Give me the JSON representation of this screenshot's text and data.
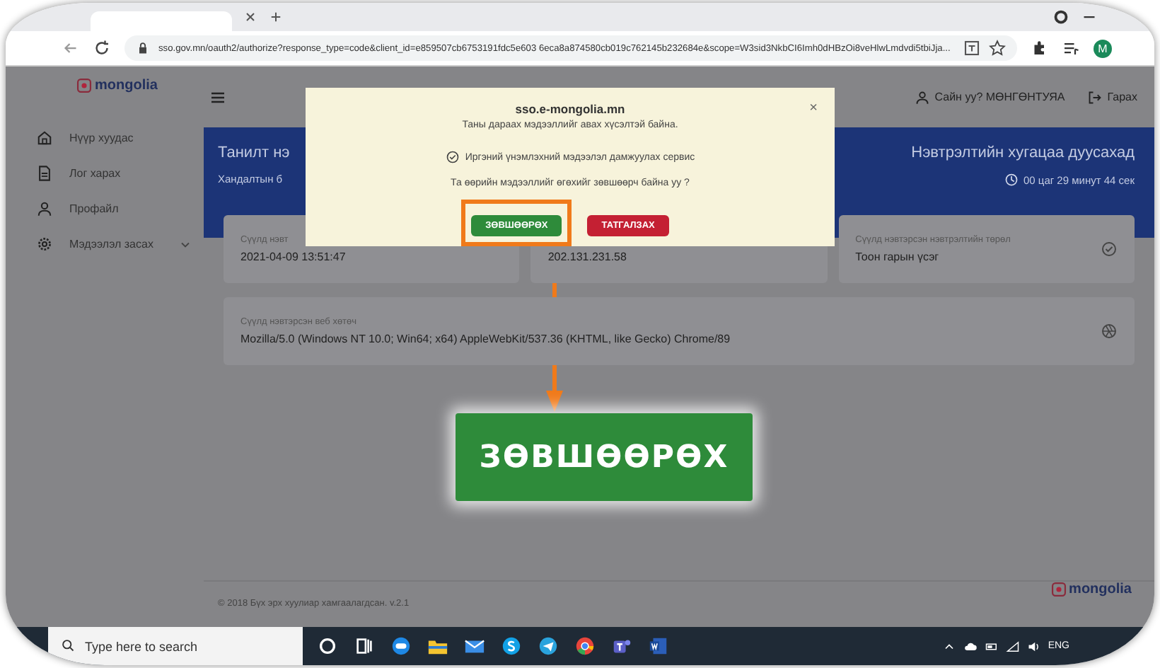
{
  "browser": {
    "url": "sso.gov.mn/oauth2/authorize?response_type=code&client_id=e859507cb6753191fdc5e603 6eca8a874580cb019c762145b232684e&scope=W3sid3NkbCI6Imh0dHBzOi8veHlwLmdvdi5tbiJja...",
    "profile_initial": "M"
  },
  "sidebar": {
    "logo": "mongolia",
    "items": [
      {
        "label": "Нүүр хуудас",
        "selected": false
      },
      {
        "label": "Лог харах",
        "selected": false
      },
      {
        "label": "Профайл",
        "selected": false
      },
      {
        "label": "Мэдээлэл засах",
        "selected": false,
        "expandable": true
      }
    ]
  },
  "header": {
    "greeting": "Сайн уу? МӨНГӨНТУЯА",
    "logout": "Гарах"
  },
  "banner": {
    "title": "Танилт нэ",
    "subtitle": "Хандалтын б",
    "expiry_title": "Нэвтрэлтийн хугацаа дуусахад",
    "countdown": "00 цаг 29 минут 44 сек"
  },
  "cards": [
    {
      "label": "Сүүлд нэвт",
      "value": "2021-04-09 13:51:47"
    },
    {
      "value": "202.131.231.58"
    },
    {
      "label": "Сүүлд нэвтэрсэн нэвтрэлтийн төрөл",
      "value": "Тоон гарын үсэг",
      "kind": "check"
    }
  ],
  "browser_card": {
    "label": "Сүүлд нэвтэрсэн веб хөтөч",
    "value": "Mozilla/5.0 (Windows NT 10.0; Win64; x64) AppleWebKit/537.36 (KHTML, like Gecko) Chrome/89"
  },
  "footer": {
    "copyright": "© 2018 Бүх эрх хуулиар хамгаалагдсан. v.2.1",
    "logo": "mongolia"
  },
  "dialog": {
    "site": "sso.e-mongolia.mn",
    "request": "Таны дараах мэдээллийг авах хүсэлтэй байна.",
    "service": "Иргэний үнэмлэхний мэдээлэл дамжуулах сервис",
    "question": "Та өөрийн мэдээллийг өгөхийг зөвшөөрч байна уу ?",
    "close": "×",
    "buttons": [
      {
        "label": "ЗӨВШӨӨРӨХ",
        "kind": "accept",
        "highlighted": true
      },
      {
        "label": "ТАТГАЛЗАХ",
        "kind": "reject",
        "highlighted": false
      }
    ]
  },
  "callout": {
    "label": "ЗӨВШӨӨРӨХ"
  },
  "taskbar": {
    "search_placeholder": "Type here to search",
    "language": "ENG"
  }
}
